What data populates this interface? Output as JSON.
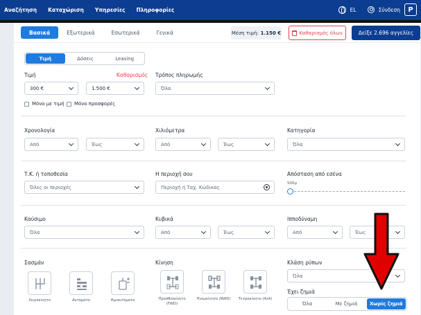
{
  "topnav": [
    "Αναζήτηση",
    "Καταχώριση",
    "Υπηρεσίες",
    "Πληροφορίες"
  ],
  "lang": "EL",
  "login": "Σύνδεση",
  "brand": "P",
  "tabs": [
    "Βασικά",
    "Εξωτερικά",
    "Εσωτερικά",
    "Γενικά"
  ],
  "avg_label": "Μέση τιμή:",
  "avg_value": "1.150 €",
  "clear_all": "Καθαρισμός όλων",
  "show_btn": "Δείξε 2.696 αγγελίες",
  "price_tabs": [
    "Τιμή",
    "Δόσεις",
    "Leasing"
  ],
  "price": {
    "label": "Τιμή",
    "clear": "Καθαρισμός",
    "from": "300 €",
    "to": "1.500 €"
  },
  "payment": {
    "label": "Τρόπος πληρωμής",
    "value": "Όλα"
  },
  "chk1": "Μόνο με τιμή",
  "chk2": "Μόνο προσφορές",
  "year": {
    "label": "Χρονολογία",
    "from": "Από",
    "to": "Έως"
  },
  "km": {
    "label": "Χιλιόμετρα",
    "from": "Από",
    "to": "Έως"
  },
  "category": {
    "label": "Κατηγορία",
    "value": "Όλα"
  },
  "zip": {
    "label": "Τ.Κ. ή τοποθεσία",
    "value": "Όλες οι περιοχές"
  },
  "area": {
    "label": "Η περιοχή σου",
    "placeholder": "Περιοχή ή Ταχ. Κώδικας"
  },
  "distance": {
    "label": "Απόσταση από εσένα",
    "value": "500μ"
  },
  "fuel": {
    "label": "Καύσιμο",
    "value": "Όλα"
  },
  "cc": {
    "label": "Κυβικά",
    "from": "Από",
    "to": "Έως"
  },
  "hp": {
    "label": "Ιπποδύναμη",
    "from": "Από",
    "to": "Έως"
  },
  "gearbox": {
    "label": "Σασμάν",
    "items": [
      "Χειροκίνητο",
      "Αυτόματο",
      "Ημιαυτόματο"
    ]
  },
  "drive": {
    "label": "Κίνηση",
    "items": [
      "Προσθιοκίνητο (FWD)",
      "Πισωκίνητο (RWD)",
      "Τετρακίνητο (4x4)"
    ]
  },
  "emission": {
    "label": "Κλάση ρύπων",
    "value": "Όλα"
  },
  "damage": {
    "label": "Έχει ζημιά",
    "options": [
      "Όλα",
      "Με ζημιά",
      "Χωρίς ζημιά"
    ],
    "selected": "Χωρίς ζημιά"
  },
  "colors": {
    "nav": "#0b3d91",
    "accent": "#1f7be0",
    "danger": "#e0434a",
    "annotation": "#e00000"
  }
}
